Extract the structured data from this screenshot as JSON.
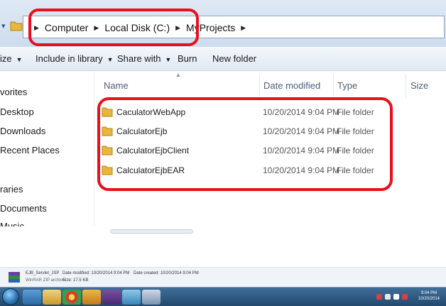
{
  "address": {
    "crumbs": [
      "Computer",
      "Local Disk (C:)",
      "MyProjects"
    ]
  },
  "toolbar": {
    "organize_label": "ize",
    "include_label": "Include in library",
    "share_label": "Share with",
    "burn_label": "Burn",
    "new_folder_label": "New folder"
  },
  "nav": {
    "items": [
      "vorites",
      "Desktop",
      "Downloads",
      "Recent Places",
      "raries",
      "Documents",
      "Music"
    ]
  },
  "columns": {
    "name": "Name",
    "date": "Date modified",
    "type": "Type",
    "size": "Size"
  },
  "files": [
    {
      "name": "CaculatorWebApp",
      "date": "10/20/2014 9:04 PM",
      "type": "File folder"
    },
    {
      "name": "CalculatorEjb",
      "date": "10/20/2014 9:04 PM",
      "type": "File folder"
    },
    {
      "name": "CalculatorEjbClient",
      "date": "10/20/2014 9:04 PM",
      "type": "File folder"
    },
    {
      "name": "CalculatorEjbEAR",
      "date": "10/20/2014 9:04 PM",
      "type": "File folder"
    }
  ],
  "details": {
    "file_name": "EJB_Servlet_JSP",
    "file_kind": "WinRAR ZIP archive",
    "date_modified": "Date modified: 10/20/2014 9:04 PM",
    "date_created": "Date created: 10/20/2014 9:04 PM",
    "size": "Size: 17.5 KB"
  },
  "clock": {
    "time": "9:04 PM",
    "date": "10/20/2014"
  },
  "colors": {
    "highlight_ring": "#e8101a",
    "folder": "#e8b63a",
    "taskbar": "#2f5a83"
  }
}
